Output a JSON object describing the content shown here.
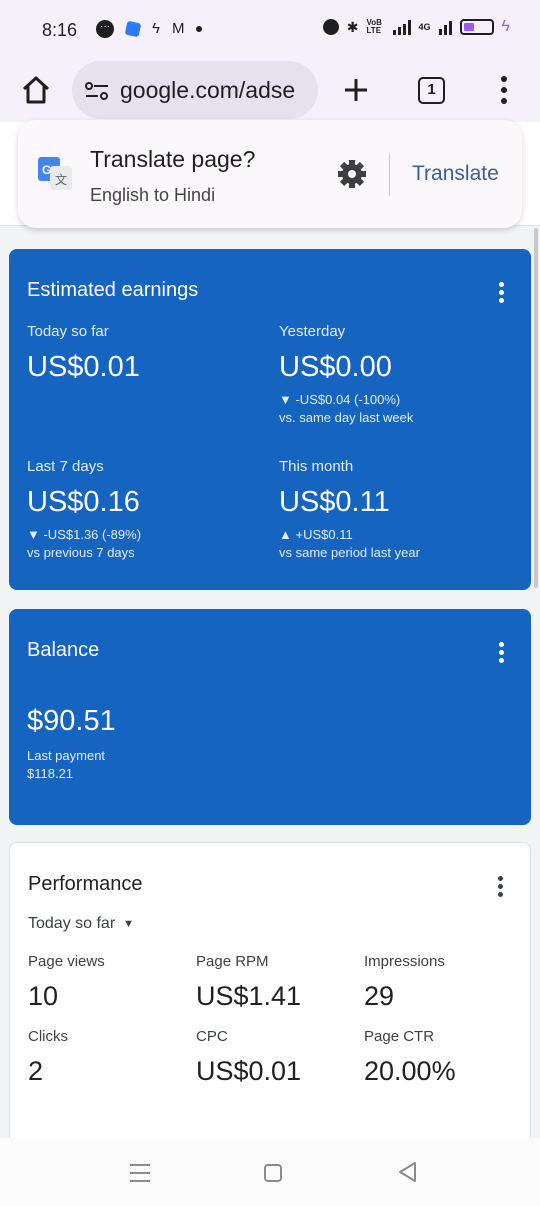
{
  "status_bar": {
    "time": "8:16",
    "network": "4G",
    "volte": "VoB LTE"
  },
  "browser": {
    "url": "google.com/adse",
    "tab_count": "1"
  },
  "translate_popup": {
    "title": "Translate page?",
    "subtitle": "English to Hindi",
    "action": "Translate"
  },
  "earnings": {
    "title": "Estimated earnings",
    "today": {
      "label": "Today so far",
      "value": "US$0.01"
    },
    "yesterday": {
      "label": "Yesterday",
      "value": "US$0.00",
      "change": "▼ -US$0.04 (-100%)",
      "compare": "vs. same day last week"
    },
    "last7": {
      "label": "Last 7 days",
      "value": "US$0.16",
      "change": "▼ -US$1.36 (-89%)",
      "compare": "vs previous 7 days"
    },
    "month": {
      "label": "This month",
      "value": "US$0.11",
      "change": "▲ +US$0.11",
      "compare": "vs same period last year"
    }
  },
  "balance": {
    "title": "Balance",
    "value": "$90.51",
    "last_payment_label": "Last payment",
    "last_payment_value": "$118.21"
  },
  "performance": {
    "title": "Performance",
    "range": "Today so far",
    "metrics": [
      {
        "label": "Page views",
        "value": "10"
      },
      {
        "label": "Page RPM",
        "value": "US$1.41"
      },
      {
        "label": "Impressions",
        "value": "29"
      },
      {
        "label": "Clicks",
        "value": "2"
      },
      {
        "label": "CPC",
        "value": "US$0.01"
      },
      {
        "label": "Page CTR",
        "value": "20.00%"
      }
    ]
  },
  "colors": {
    "card_blue": "#1565c0",
    "battery_accent": "#9c5cf0",
    "translate_text": "#3c5d99"
  }
}
